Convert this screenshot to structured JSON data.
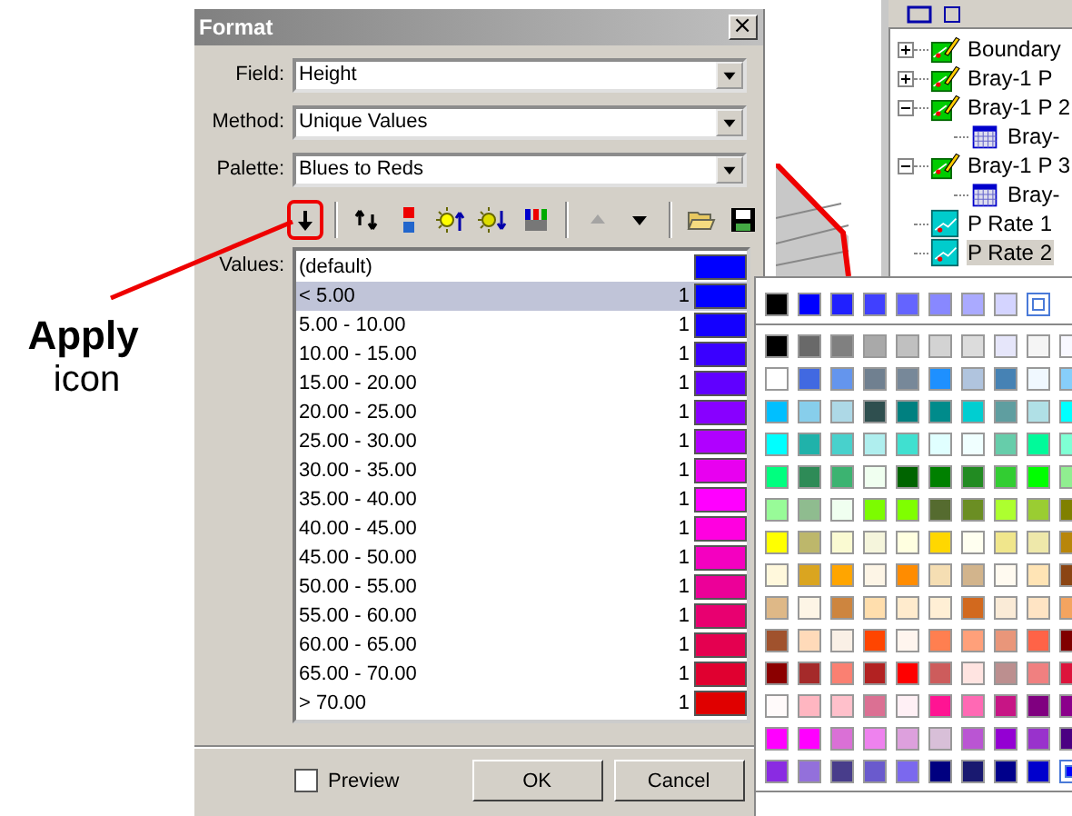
{
  "annotation": {
    "title": "Apply",
    "subtitle": "icon"
  },
  "dialog": {
    "title": "Format",
    "close": "×",
    "fields": [
      {
        "label": "Field:",
        "value": "Height"
      },
      {
        "label": "Method:",
        "value": "Unique Values"
      },
      {
        "label": "Palette:",
        "value": "Blues to Reds"
      }
    ],
    "toolbar": [
      {
        "kind": "apply",
        "highlighted": true
      },
      {
        "kind": "sep"
      },
      {
        "kind": "refresh",
        "highlighted": false
      },
      {
        "kind": "ramp",
        "highlighted": false
      },
      {
        "kind": "brighten",
        "highlighted": false
      },
      {
        "kind": "darken",
        "highlighted": false
      },
      {
        "kind": "bars",
        "highlighted": false
      },
      {
        "kind": "sep"
      },
      {
        "kind": "up",
        "highlighted": false,
        "disabled": true
      },
      {
        "kind": "down",
        "highlighted": false,
        "disabled": false
      },
      {
        "kind": "sep"
      },
      {
        "kind": "open",
        "highlighted": false
      },
      {
        "kind": "save",
        "highlighted": false
      }
    ],
    "values_label": "Values:",
    "values": [
      {
        "label": "(default)",
        "selected": false,
        "color": "#0000ff"
      },
      {
        "label": "< 5.00",
        "count": "1",
        "selected": true,
        "color": "#0000ff"
      },
      {
        "label": "5.00 - 10.00",
        "count": "1",
        "selected": false,
        "color": "#1400ff"
      },
      {
        "label": "10.00 - 15.00",
        "count": "1",
        "selected": false,
        "color": "#3a00ff"
      },
      {
        "label": "15.00 - 20.00",
        "count": "1",
        "selected": false,
        "color": "#6000ff"
      },
      {
        "label": "20.00 - 25.00",
        "count": "1",
        "selected": false,
        "color": "#8800ff"
      },
      {
        "label": "25.00 - 30.00",
        "count": "1",
        "selected": false,
        "color": "#b000ff"
      },
      {
        "label": "30.00 - 35.00",
        "count": "1",
        "selected": false,
        "color": "#e800f0"
      },
      {
        "label": "35.00 - 40.00",
        "count": "1",
        "selected": false,
        "color": "#ff00ff"
      },
      {
        "label": "40.00 - 45.00",
        "count": "1",
        "selected": false,
        "color": "#ff00e0"
      },
      {
        "label": "45.00 - 50.00",
        "count": "1",
        "selected": false,
        "color": "#f400c0"
      },
      {
        "label": "50.00 - 55.00",
        "count": "1",
        "selected": false,
        "color": "#ec0098"
      },
      {
        "label": "55.00 - 60.00",
        "count": "1",
        "selected": false,
        "color": "#e80070"
      },
      {
        "label": "60.00 - 65.00",
        "count": "1",
        "selected": false,
        "color": "#e40050"
      },
      {
        "label": "65.00 - 70.00",
        "count": "1",
        "selected": false,
        "color": "#e00030"
      },
      {
        "label": "> 70.00",
        "count": "1",
        "selected": false,
        "color": "#e00000"
      }
    ],
    "preview": {
      "label": "Preview",
      "checked": false
    },
    "buttons": [
      "OK",
      "Cancel"
    ]
  },
  "layers": [
    {
      "label": "Boundary",
      "kind": "vector",
      "expanded": false,
      "selected": false
    },
    {
      "label": "Bray-1 P",
      "kind": "vector",
      "expanded": false,
      "selected": false
    },
    {
      "label": "Bray-1 P 2",
      "kind": "vector",
      "expanded": true,
      "selected": false,
      "children": [
        {
          "label": "Bray-",
          "kind": "grid",
          "selected": false
        }
      ]
    },
    {
      "label": "Bray-1 P 3",
      "kind": "vector",
      "expanded": true,
      "selected": false,
      "children": [
        {
          "label": "Bray-",
          "kind": "grid",
          "selected": false
        }
      ]
    },
    {
      "label": "P Rate 1",
      "kind": "raster",
      "selected": false
    },
    {
      "label": "P Rate 2",
      "kind": "raster",
      "selected": true
    }
  ],
  "palette": {
    "recent": [
      {
        "color": "#000000",
        "selected": false
      },
      {
        "color": "#0000ff",
        "selected": false
      },
      {
        "color": "#2020ff",
        "selected": false
      },
      {
        "color": "#4040ff",
        "selected": false
      },
      {
        "color": "#6464ff",
        "selected": false
      },
      {
        "color": "#8888ff",
        "selected": false
      },
      {
        "color": "#aaaaff",
        "selected": false
      },
      {
        "color": "#d4d4ff",
        "selected": false
      },
      {
        "color": "#ffffff",
        "selected": true
      }
    ],
    "rows": [
      {
        "swatches": [
          {
            "color": "#000000",
            "selected": false
          },
          {
            "color": "#696969",
            "selected": false
          },
          {
            "color": "#808080",
            "selected": false
          },
          {
            "color": "#a9a9a9",
            "selected": false
          },
          {
            "color": "#c0c0c0",
            "selected": false
          },
          {
            "color": "#d3d3d3",
            "selected": false
          },
          {
            "color": "#dcdcdc",
            "selected": false
          },
          {
            "color": "#e6e6fa",
            "selected": false
          },
          {
            "color": "#f5f5f5",
            "selected": false
          },
          {
            "color": "#f8f8ff",
            "selected": false
          }
        ]
      },
      {
        "swatches": [
          {
            "color": "#ffffff",
            "selected": false
          },
          {
            "color": "#4169e1",
            "selected": false
          },
          {
            "color": "#6495ed",
            "selected": false
          },
          {
            "color": "#708090",
            "selected": false
          },
          {
            "color": "#778899",
            "selected": false
          },
          {
            "color": "#1e90ff",
            "selected": false
          },
          {
            "color": "#b0c4de",
            "selected": false
          },
          {
            "color": "#4682b4",
            "selected": false
          },
          {
            "color": "#f0f8ff",
            "selected": false
          },
          {
            "color": "#87cefa",
            "selected": false
          }
        ]
      },
      {
        "swatches": [
          {
            "color": "#00bfff",
            "selected": false
          },
          {
            "color": "#87ceeb",
            "selected": false
          },
          {
            "color": "#add8e6",
            "selected": false
          },
          {
            "color": "#2f4f4f",
            "selected": false
          },
          {
            "color": "#008080",
            "selected": false
          },
          {
            "color": "#008b8b",
            "selected": false
          },
          {
            "color": "#00ced1",
            "selected": false
          },
          {
            "color": "#5f9ea0",
            "selected": false
          },
          {
            "color": "#b0e0e6",
            "selected": false
          },
          {
            "color": "#00ffff",
            "selected": false
          }
        ]
      },
      {
        "swatches": [
          {
            "color": "#00ffff",
            "selected": false
          },
          {
            "color": "#20b2aa",
            "selected": false
          },
          {
            "color": "#48d1cc",
            "selected": false
          },
          {
            "color": "#afeeee",
            "selected": false
          },
          {
            "color": "#40e0d0",
            "selected": false
          },
          {
            "color": "#e0ffff",
            "selected": false
          },
          {
            "color": "#f0ffff",
            "selected": false
          },
          {
            "color": "#66cdaa",
            "selected": false
          },
          {
            "color": "#00fa9a",
            "selected": false
          },
          {
            "color": "#7fffd4",
            "selected": false
          }
        ]
      },
      {
        "swatches": [
          {
            "color": "#00ff7f",
            "selected": false
          },
          {
            "color": "#2e8b57",
            "selected": false
          },
          {
            "color": "#3cb371",
            "selected": false
          },
          {
            "color": "#f0fff0",
            "selected": false
          },
          {
            "color": "#006400",
            "selected": false
          },
          {
            "color": "#008000",
            "selected": false
          },
          {
            "color": "#228b22",
            "selected": false
          },
          {
            "color": "#32cd32",
            "selected": false
          },
          {
            "color": "#00ff00",
            "selected": false
          },
          {
            "color": "#90ee90",
            "selected": false
          }
        ]
      },
      {
        "swatches": [
          {
            "color": "#98fb98",
            "selected": false
          },
          {
            "color": "#8fbc8f",
            "selected": false
          },
          {
            "color": "#f0fff0",
            "selected": false
          },
          {
            "color": "#7cfc00",
            "selected": false
          },
          {
            "color": "#7fff00",
            "selected": false
          },
          {
            "color": "#556b2f",
            "selected": false
          },
          {
            "color": "#6b8e23",
            "selected": false
          },
          {
            "color": "#adff2f",
            "selected": false
          },
          {
            "color": "#9acd32",
            "selected": false
          },
          {
            "color": "#808000",
            "selected": false
          }
        ]
      },
      {
        "swatches": [
          {
            "color": "#ffff00",
            "selected": false
          },
          {
            "color": "#bdb76b",
            "selected": false
          },
          {
            "color": "#fafad2",
            "selected": false
          },
          {
            "color": "#f5f5dc",
            "selected": false
          },
          {
            "color": "#ffffe0",
            "selected": false
          },
          {
            "color": "#ffd700",
            "selected": false
          },
          {
            "color": "#fffff0",
            "selected": false
          },
          {
            "color": "#f0e68c",
            "selected": false
          },
          {
            "color": "#eee8aa",
            "selected": false
          },
          {
            "color": "#b8860b",
            "selected": false
          }
        ]
      },
      {
        "swatches": [
          {
            "color": "#fff8dc",
            "selected": false
          },
          {
            "color": "#daa520",
            "selected": false
          },
          {
            "color": "#ffa500",
            "selected": false
          },
          {
            "color": "#fdf5e6",
            "selected": false
          },
          {
            "color": "#ff8c00",
            "selected": false
          },
          {
            "color": "#f5deb3",
            "selected": false
          },
          {
            "color": "#d2b48c",
            "selected": false
          },
          {
            "color": "#fffaf0",
            "selected": false
          },
          {
            "color": "#ffe4b5",
            "selected": false
          },
          {
            "color": "#8b4513",
            "selected": false
          }
        ]
      },
      {
        "swatches": [
          {
            "color": "#deb887",
            "selected": false
          },
          {
            "color": "#fdf5e6",
            "selected": false
          },
          {
            "color": "#cd853f",
            "selected": false
          },
          {
            "color": "#ffdead",
            "selected": false
          },
          {
            "color": "#ffebcd",
            "selected": false
          },
          {
            "color": "#ffefd5",
            "selected": false
          },
          {
            "color": "#d2691e",
            "selected": false
          },
          {
            "color": "#faebd7",
            "selected": false
          },
          {
            "color": "#ffe4c4",
            "selected": false
          },
          {
            "color": "#f4a460",
            "selected": false
          }
        ]
      },
      {
        "swatches": [
          {
            "color": "#a0522d",
            "selected": false
          },
          {
            "color": "#ffdab9",
            "selected": false
          },
          {
            "color": "#faf0e6",
            "selected": false
          },
          {
            "color": "#ff4500",
            "selected": false
          },
          {
            "color": "#fff5ee",
            "selected": false
          },
          {
            "color": "#ff7f50",
            "selected": false
          },
          {
            "color": "#ffa07a",
            "selected": false
          },
          {
            "color": "#e9967a",
            "selected": false
          },
          {
            "color": "#ff6347",
            "selected": false
          },
          {
            "color": "#800000",
            "selected": false
          }
        ]
      },
      {
        "swatches": [
          {
            "color": "#8b0000",
            "selected": false
          },
          {
            "color": "#a52a2a",
            "selected": false
          },
          {
            "color": "#fa8072",
            "selected": false
          },
          {
            "color": "#b22222",
            "selected": false
          },
          {
            "color": "#ff0000",
            "selected": false
          },
          {
            "color": "#cd5c5c",
            "selected": false
          },
          {
            "color": "#ffe4e1",
            "selected": false
          },
          {
            "color": "#bc8f8f",
            "selected": false
          },
          {
            "color": "#f08080",
            "selected": false
          },
          {
            "color": "#dc143c",
            "selected": false
          }
        ]
      },
      {
        "swatches": [
          {
            "color": "#fffafa",
            "selected": false
          },
          {
            "color": "#ffb6c1",
            "selected": false
          },
          {
            "color": "#ffc0cb",
            "selected": false
          },
          {
            "color": "#db7093",
            "selected": false
          },
          {
            "color": "#fff0f5",
            "selected": false
          },
          {
            "color": "#ff1493",
            "selected": false
          },
          {
            "color": "#ff69b4",
            "selected": false
          },
          {
            "color": "#c71585",
            "selected": false
          },
          {
            "color": "#800080",
            "selected": false
          },
          {
            "color": "#8b008b",
            "selected": false
          }
        ]
      },
      {
        "swatches": [
          {
            "color": "#ff00ff",
            "selected": false
          },
          {
            "color": "#ff00ff",
            "selected": false
          },
          {
            "color": "#da70d6",
            "selected": false
          },
          {
            "color": "#ee82ee",
            "selected": false
          },
          {
            "color": "#dda0dd",
            "selected": false
          },
          {
            "color": "#d8bfd8",
            "selected": false
          },
          {
            "color": "#ba55d3",
            "selected": false
          },
          {
            "color": "#9400d3",
            "selected": false
          },
          {
            "color": "#9932cc",
            "selected": false
          },
          {
            "color": "#4b0082",
            "selected": false
          }
        ]
      },
      {
        "swatches": [
          {
            "color": "#8a2be2",
            "selected": false
          },
          {
            "color": "#9370db",
            "selected": false
          },
          {
            "color": "#483d8b",
            "selected": false
          },
          {
            "color": "#6a5acd",
            "selected": false
          },
          {
            "color": "#7b68ee",
            "selected": false
          },
          {
            "color": "#000080",
            "selected": false
          },
          {
            "color": "#191970",
            "selected": false
          },
          {
            "color": "#00008b",
            "selected": false
          },
          {
            "color": "#0000cd",
            "selected": false
          },
          {
            "color": "#0000ff",
            "selected": true
          }
        ]
      }
    ]
  }
}
